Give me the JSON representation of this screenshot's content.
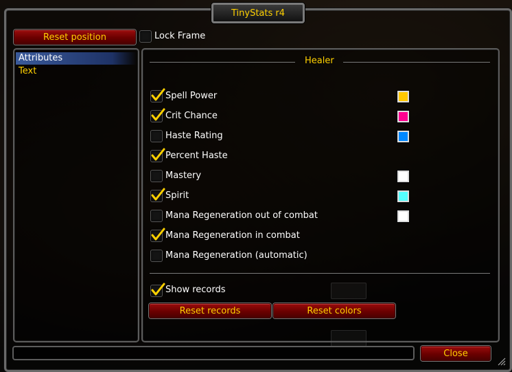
{
  "window": {
    "title": "TinyStats r4"
  },
  "header": {
    "reset_position_label": "Reset position",
    "lock_frame_label": "Lock Frame",
    "lock_frame_checked": false
  },
  "sidebar": {
    "items": [
      {
        "label": "Attributes",
        "active": true
      },
      {
        "label": "Text",
        "active": false
      }
    ]
  },
  "main": {
    "section_title": "Healer",
    "options": [
      {
        "label": "Spell Power",
        "checked": true,
        "color": "#ffc800"
      },
      {
        "label": "Crit Chance",
        "checked": true,
        "color": "#ff0090"
      },
      {
        "label": "Haste Rating",
        "checked": false,
        "color": "#0088ff"
      },
      {
        "label": "Percent Haste",
        "checked": true,
        "color": null
      },
      {
        "label": "Mastery",
        "checked": false,
        "color": "#ffffff"
      },
      {
        "label": "Spirit",
        "checked": true,
        "color": "#55ffff"
      },
      {
        "label": "Mana Regeneration out of combat",
        "checked": false,
        "color": "#ffffff"
      },
      {
        "label": "Mana Regeneration in combat",
        "checked": true,
        "color": null
      },
      {
        "label": "Mana Regeneration (automatic)",
        "checked": false,
        "color": null
      }
    ],
    "show_records_label": "Show records",
    "show_records_checked": true,
    "reset_records_label": "Reset records",
    "reset_colors_label": "Reset colors"
  },
  "footer": {
    "close_label": "Close"
  },
  "theme": {
    "accent": "#ffd100",
    "button_red": "#8a0000"
  }
}
